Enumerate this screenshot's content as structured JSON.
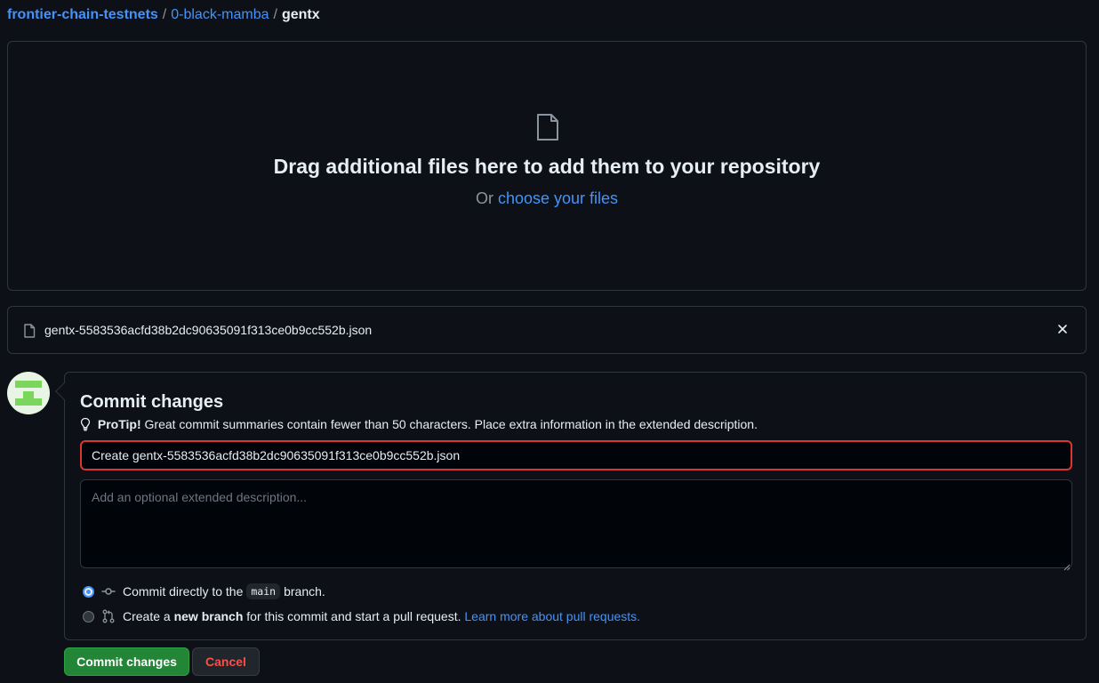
{
  "breadcrumb": {
    "owner": "frontier-chain-testnets",
    "repo": "0-black-mamba",
    "separator": "/",
    "current": "gentx"
  },
  "dropzone": {
    "icon": "file-icon",
    "heading": "Drag additional files here to add them to your repository",
    "or_text": "Or",
    "choose_link": "choose your files"
  },
  "uploaded_file": {
    "name": "gentx-5583536acfd38b2dc90635091f313ce0b9cc552b.json",
    "remove_icon": "close-icon"
  },
  "commit": {
    "title": "Commit changes",
    "protip_label": "ProTip!",
    "protip_text": "Great commit summaries contain fewer than 50 characters. Place extra information in the extended description.",
    "summary_value": "Create gentx-5583536acfd38b2dc90635091f313ce0b9cc552b.json",
    "description_placeholder": "Add an optional extended description...",
    "option_direct": {
      "before": "Commit directly to the",
      "branch": "main",
      "after": "branch.",
      "checked": true
    },
    "option_new_branch": {
      "before": "Create a",
      "bold": "new branch",
      "after": "for this commit and start a pull request.",
      "link": "Learn more about pull requests.",
      "checked": false
    }
  },
  "buttons": {
    "commit": "Commit changes",
    "cancel": "Cancel"
  },
  "colors": {
    "background": "#0d1117",
    "link": "#4493f8",
    "primary_button": "#238636",
    "danger": "#f85149",
    "input_error_border": "#da3633"
  }
}
